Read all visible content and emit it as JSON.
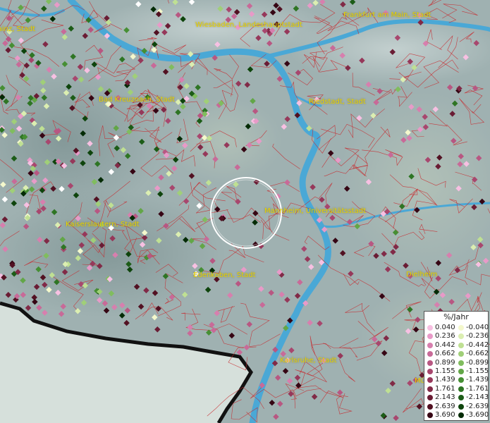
{
  "map": {
    "cities": [
      {
        "name": "Wiesbaden, Landeshauptstadt"
      },
      {
        "name": "Frankfurt am Main, Stadt"
      },
      {
        "name": "Mainz, Stadt"
      },
      {
        "name": "Bad Kreuznach, Stadt"
      },
      {
        "name": "Riedstadt, Stadt"
      },
      {
        "name": "Mannheim, Universitätsstadt"
      },
      {
        "name": "Kaiserslautern, Stadt"
      },
      {
        "name": "Edenkoben, Stadt"
      },
      {
        "name": "Dielheim"
      },
      {
        "name": "Karlsruhe, Stadt"
      },
      {
        "name": "Mü"
      }
    ],
    "label_color": "#e8d400",
    "river_color": "#4aa8d6",
    "boundary_color": "#c8262a",
    "land_color": "#9fb1b1"
  },
  "legend": {
    "title": "%/Jahr",
    "positive": [
      {
        "label": "0.040",
        "color": "#f7c0e2"
      },
      {
        "label": "0.236",
        "color": "#e89ac8"
      },
      {
        "label": "0.442",
        "color": "#d77fae"
      },
      {
        "label": "0.662",
        "color": "#c86a98"
      },
      {
        "label": "0.899",
        "color": "#b85782"
      },
      {
        "label": "1.155",
        "color": "#a8476e"
      },
      {
        "label": "1.439",
        "color": "#96385a"
      },
      {
        "label": "1.761",
        "color": "#812a47"
      },
      {
        "label": "2.143",
        "color": "#6a1c34"
      },
      {
        "label": "2.639",
        "color": "#521122"
      },
      {
        "label": "3.690",
        "color": "#360614"
      }
    ],
    "negative": [
      {
        "label": "-0.040",
        "color": "#f4f8cc"
      },
      {
        "label": "-0.236",
        "color": "#dbeeb1"
      },
      {
        "label": "-0.442",
        "color": "#bfe093"
      },
      {
        "label": "-0.662",
        "color": "#a0cf78"
      },
      {
        "label": "-0.899",
        "color": "#80bd5e"
      },
      {
        "label": "-1.155",
        "color": "#62a647"
      },
      {
        "label": "-1.439",
        "color": "#468f34"
      },
      {
        "label": "-1.761",
        "color": "#2e7524"
      },
      {
        "label": "-2.143",
        "color": "#1c5c17"
      },
      {
        "label": "-2.639",
        "color": "#0e440c"
      },
      {
        "label": "-3.690",
        "color": "#032b05"
      }
    ]
  }
}
